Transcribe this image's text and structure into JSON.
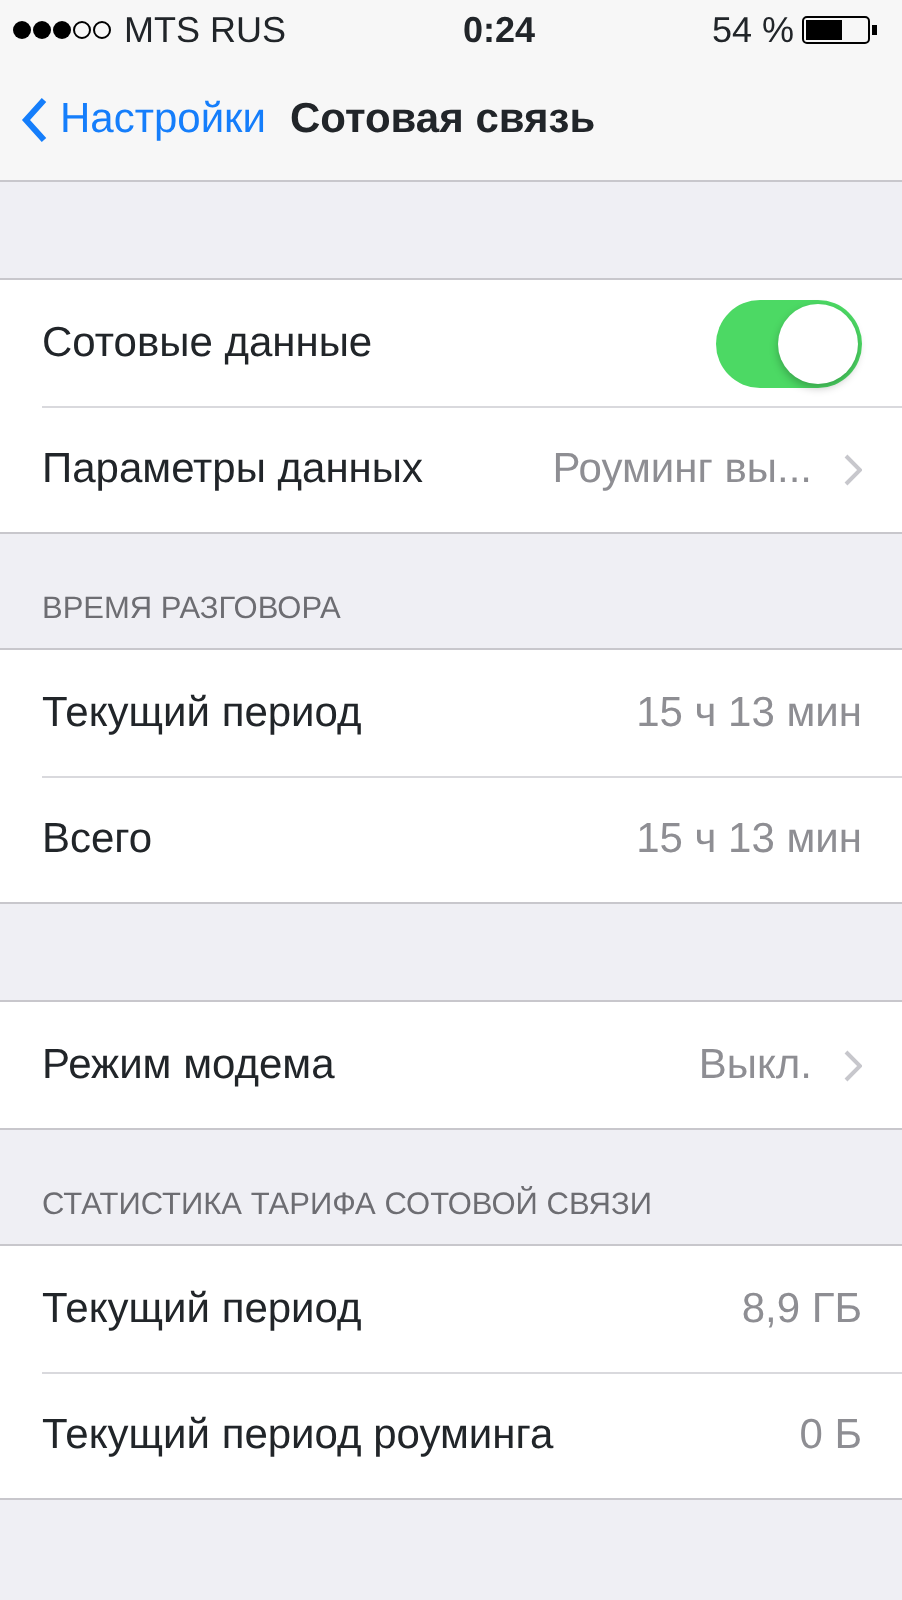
{
  "status_bar": {
    "carrier": "MTS RUS",
    "time": "0:24",
    "battery": "54 %"
  },
  "nav": {
    "back": "Настройки",
    "title": "Сотовая связь"
  },
  "sections": [
    {
      "rows": [
        {
          "kind": "toggle",
          "label": "Сотовые данные",
          "on": true
        },
        {
          "kind": "disclosure",
          "label": "Параметры данных",
          "value": "Роуминг вы..."
        }
      ]
    },
    {
      "header": "ВРЕМЯ РАЗГОВОРА",
      "rows": [
        {
          "kind": "value",
          "label": "Текущий период",
          "value": "15 ч 13 мин"
        },
        {
          "kind": "value",
          "label": "Всего",
          "value": "15 ч 13 мин"
        }
      ]
    },
    {
      "rows": [
        {
          "kind": "disclosure",
          "label": "Режим модема",
          "value": "Выкл."
        }
      ]
    },
    {
      "header": "СТАТИСТИКА ТАРИФА СОТОВОЙ СВЯЗИ",
      "rows": [
        {
          "kind": "value",
          "label": "Текущий период",
          "value": "8,9 ГБ"
        },
        {
          "kind": "value",
          "label": "Текущий период роуминга",
          "value": "0 Б"
        }
      ]
    }
  ]
}
